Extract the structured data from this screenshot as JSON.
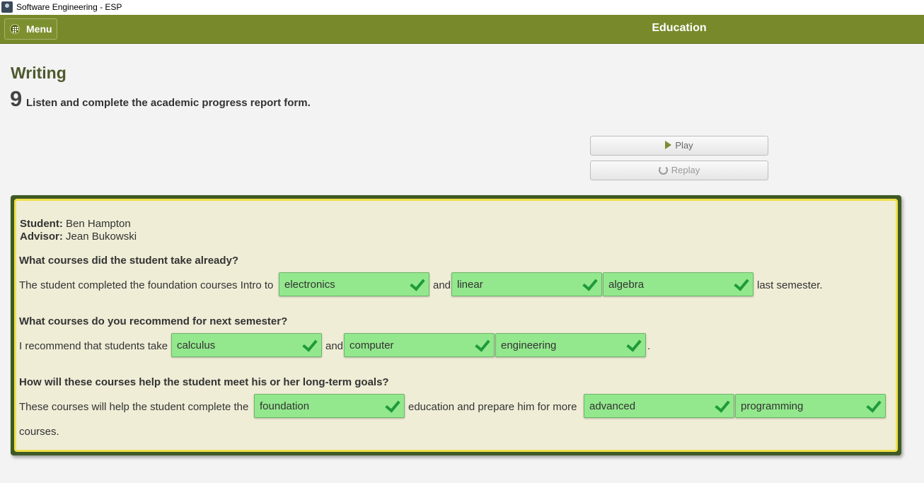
{
  "window": {
    "title": "Software Engineering - ESP"
  },
  "header": {
    "menu_label": "Menu",
    "title": "Education"
  },
  "section": {
    "title": "Writing",
    "number": "9",
    "instruction": "Listen and complete the academic progress report form."
  },
  "audio": {
    "play_label": "Play",
    "replay_label": "Replay"
  },
  "report": {
    "student_label": "Student:",
    "student_name": "Ben Hampton",
    "advisor_label": "Advisor:",
    "advisor_name": "Jean Bukowski",
    "q1": {
      "question": "What courses did the student take already?",
      "text_1": "The student completed the foundation courses Intro to",
      "answer_1": "electronics",
      "text_2": "and",
      "answer_2": "linear",
      "answer_3": "algebra",
      "text_3": "last semester."
    },
    "q2": {
      "question": "What courses do you recommend for next semester?",
      "text_1": "I recommend that students take",
      "answer_1": "calculus",
      "text_2": "and",
      "answer_2": "computer",
      "answer_3": "engineering",
      "text_3": "."
    },
    "q3": {
      "question": "How will these courses help the student meet his or her long-term goals?",
      "text_1": "These courses will help the student complete the",
      "answer_1": "foundation",
      "text_2": "education and prepare him for more",
      "answer_2": "advanced",
      "answer_3": "programming",
      "text_3": "courses."
    }
  },
  "colors": {
    "header": "#77892a",
    "panel_border": "#3e5a24",
    "panel_bg": "#efedd6",
    "correct": "#93e88d",
    "check": "#1f9a3a"
  },
  "icons": {
    "menu": "grid-icon",
    "play": "play-icon",
    "replay": "replay-icon",
    "correct": "check-icon"
  }
}
